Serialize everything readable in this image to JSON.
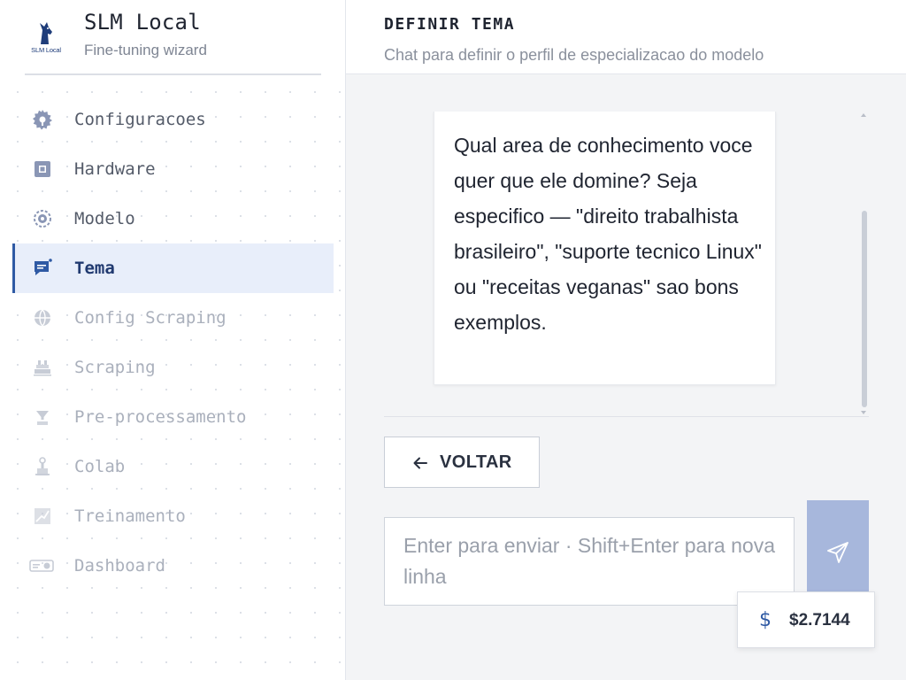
{
  "app": {
    "title": "SLM Local",
    "subtitle": "Fine-tuning wizard",
    "logo_text": "SLM Local",
    "logo_icon": "wolf-logo"
  },
  "sidebar": {
    "items": [
      {
        "label": "Configuracoes",
        "icon": "gear-icon",
        "state": "done"
      },
      {
        "label": "Hardware",
        "icon": "chip-icon",
        "state": "done"
      },
      {
        "label": "Modelo",
        "icon": "brain-icon",
        "state": "done"
      },
      {
        "label": "Tema",
        "icon": "chat-icon",
        "state": "active"
      },
      {
        "label": "Config Scraping",
        "icon": "globe-icon",
        "state": "pending"
      },
      {
        "label": "Scraping",
        "icon": "crawler-icon",
        "state": "pending"
      },
      {
        "label": "Pre-processamento",
        "icon": "filter-icon",
        "state": "pending"
      },
      {
        "label": "Colab",
        "icon": "flask-icon",
        "state": "pending"
      },
      {
        "label": "Treinamento",
        "icon": "chart-icon",
        "state": "pending"
      },
      {
        "label": "Dashboard",
        "icon": "dashboard-icon",
        "state": "pending"
      }
    ]
  },
  "header": {
    "title": "DEFINIR TEMA",
    "subtitle": "Chat para definir o perfil de especializacao do modelo"
  },
  "chat": {
    "message": "Qual area de conhecimento voce quer que ele domine? Seja especifico — \"direito trabalhista brasileiro\", \"suporte tecnico Linux\" ou \"receitas veganas\" sao bons exemplos."
  },
  "actions": {
    "back_label": "VOLTAR"
  },
  "input": {
    "value": "",
    "placeholder": "Enter para enviar · Shift+Enter para nova linha"
  },
  "cost": {
    "symbol": "$",
    "value": "$2.7144"
  },
  "colors": {
    "accent": "#2f5aa4",
    "active_bg": "#e8eefa",
    "send_button": "#a7b7dc"
  }
}
